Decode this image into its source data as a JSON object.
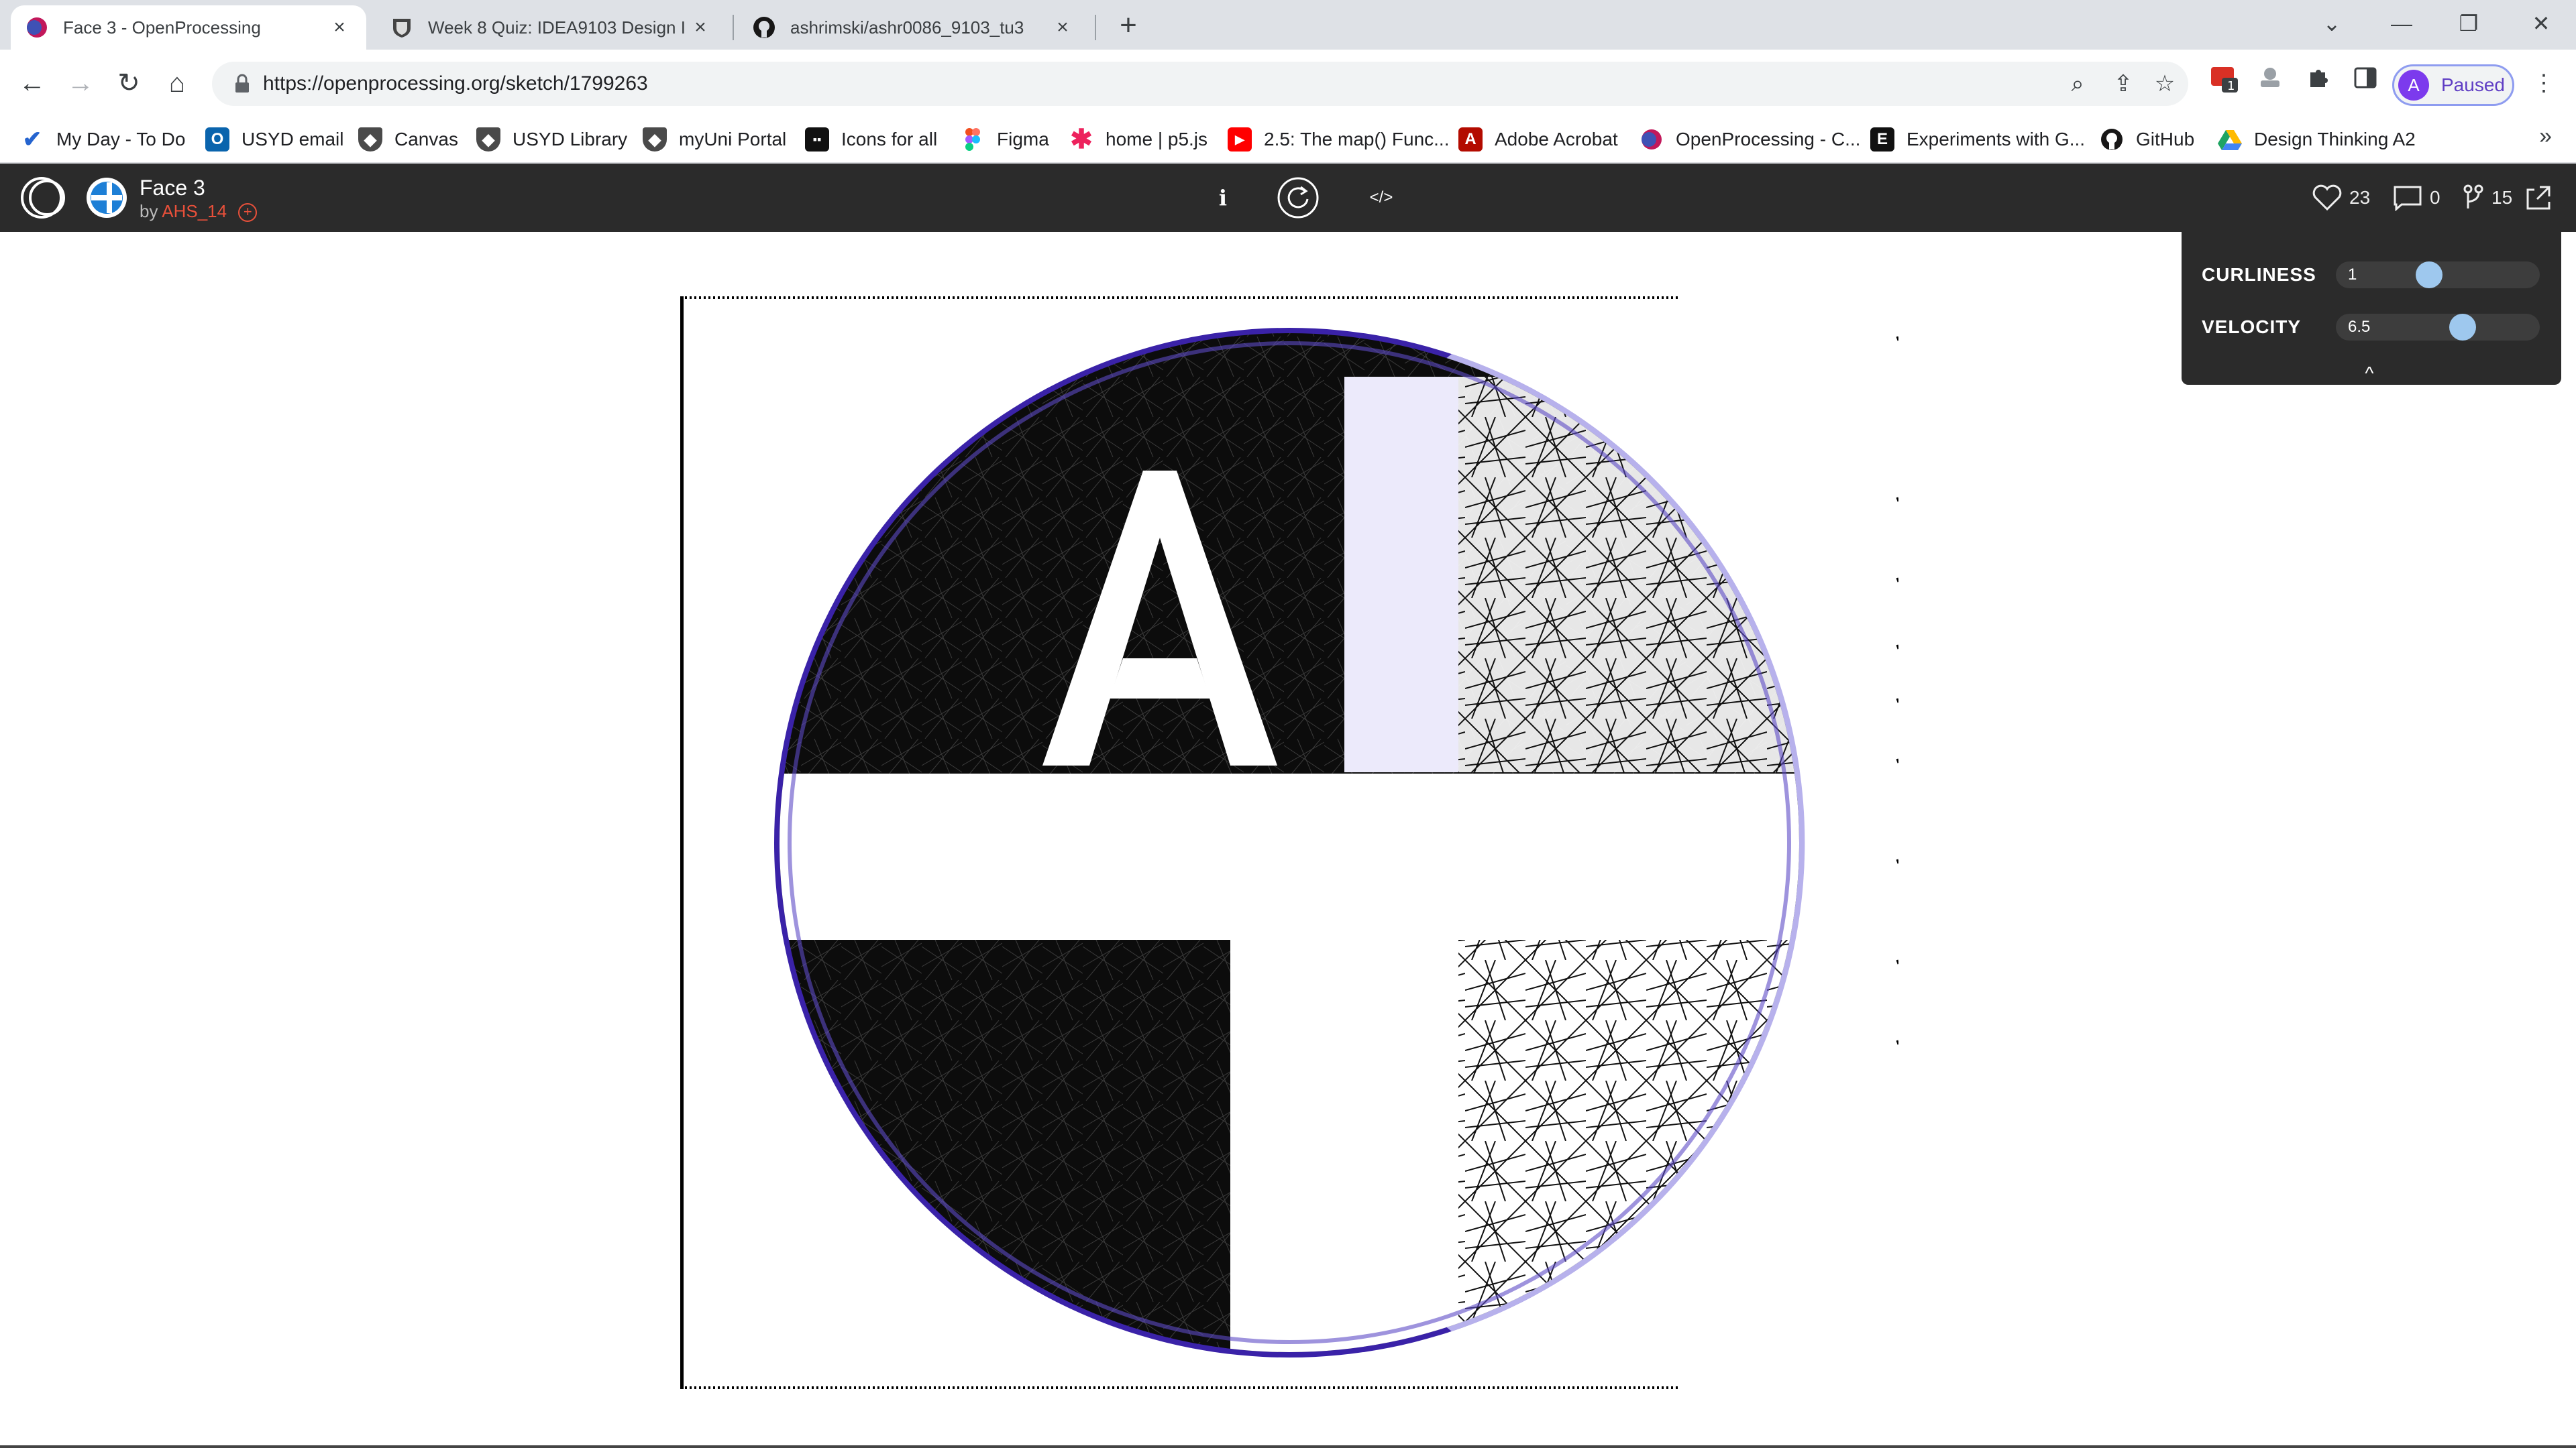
{
  "browser": {
    "tabs": [
      {
        "title": "Face 3 - OpenProcessing",
        "icon": "openprocessing-favicon",
        "active": true
      },
      {
        "title": "Week 8 Quiz: IDEA9103 Design I",
        "icon": "usyd-shield-favicon",
        "active": false
      },
      {
        "title": "ashrimski/ashr0086_9103_tu3",
        "icon": "github-favicon",
        "active": false
      }
    ],
    "new_tab": "+",
    "url": "https://openprocessing.org/sketch/1799263",
    "profile": {
      "initial": "A",
      "status": "Paused"
    },
    "extension_badge": "1",
    "bookmarks": [
      {
        "label": "My Day - To Do",
        "icon": "todo-check-icon",
        "color": "#2564cf"
      },
      {
        "label": "USYD email",
        "icon": "outlook-icon",
        "color": "#0a64ad"
      },
      {
        "label": "Canvas",
        "icon": "shield-icon",
        "color": "#4a4a4a"
      },
      {
        "label": "USYD Library",
        "icon": "shield-icon",
        "color": "#4a4a4a"
      },
      {
        "label": "myUni Portal",
        "icon": "shield-icon",
        "color": "#4a4a4a"
      },
      {
        "label": "Icons for all",
        "icon": "icons-icon",
        "color": "#111111"
      },
      {
        "label": "Figma",
        "icon": "figma-icon",
        "color": "#f24e1e"
      },
      {
        "label": "home | p5.js",
        "icon": "asterisk-icon",
        "color": "#ed225d"
      },
      {
        "label": "2.5: The map() Func...",
        "icon": "youtube-icon",
        "color": "#ff0000"
      },
      {
        "label": "Adobe Acrobat",
        "icon": "acrobat-icon",
        "color": "#b30b00"
      },
      {
        "label": "OpenProcessing - C...",
        "icon": "openprocessing-favicon",
        "color": "#c2185b"
      },
      {
        "label": "Experiments with G...",
        "icon": "e-icon",
        "color": "#111111"
      },
      {
        "label": "GitHub",
        "icon": "github-icon",
        "color": "#181717"
      },
      {
        "label": "Design Thinking A2",
        "icon": "drive-icon",
        "color": "#1fa463"
      }
    ],
    "bookmarks_more": "»"
  },
  "op": {
    "title": "Face 3",
    "by": "by",
    "author": "AHS_14",
    "info_glyph": "i",
    "code_glyph": "</>",
    "likes": "23",
    "comments": "0",
    "forks": "15"
  },
  "controls": {
    "items": [
      {
        "label": "CURLINESS",
        "value": "1",
        "level": 0.45
      },
      {
        "label": "VELOCITY",
        "value": "6.5",
        "level": 0.64
      }
    ],
    "collapse_glyph": "^"
  },
  "sketch": {
    "letters": "AI",
    "colors": {
      "ink": "#0c0c0c",
      "ring": "#3a22a8",
      "ring_light": "#8f86e0",
      "paper": "#ffffff"
    }
  }
}
